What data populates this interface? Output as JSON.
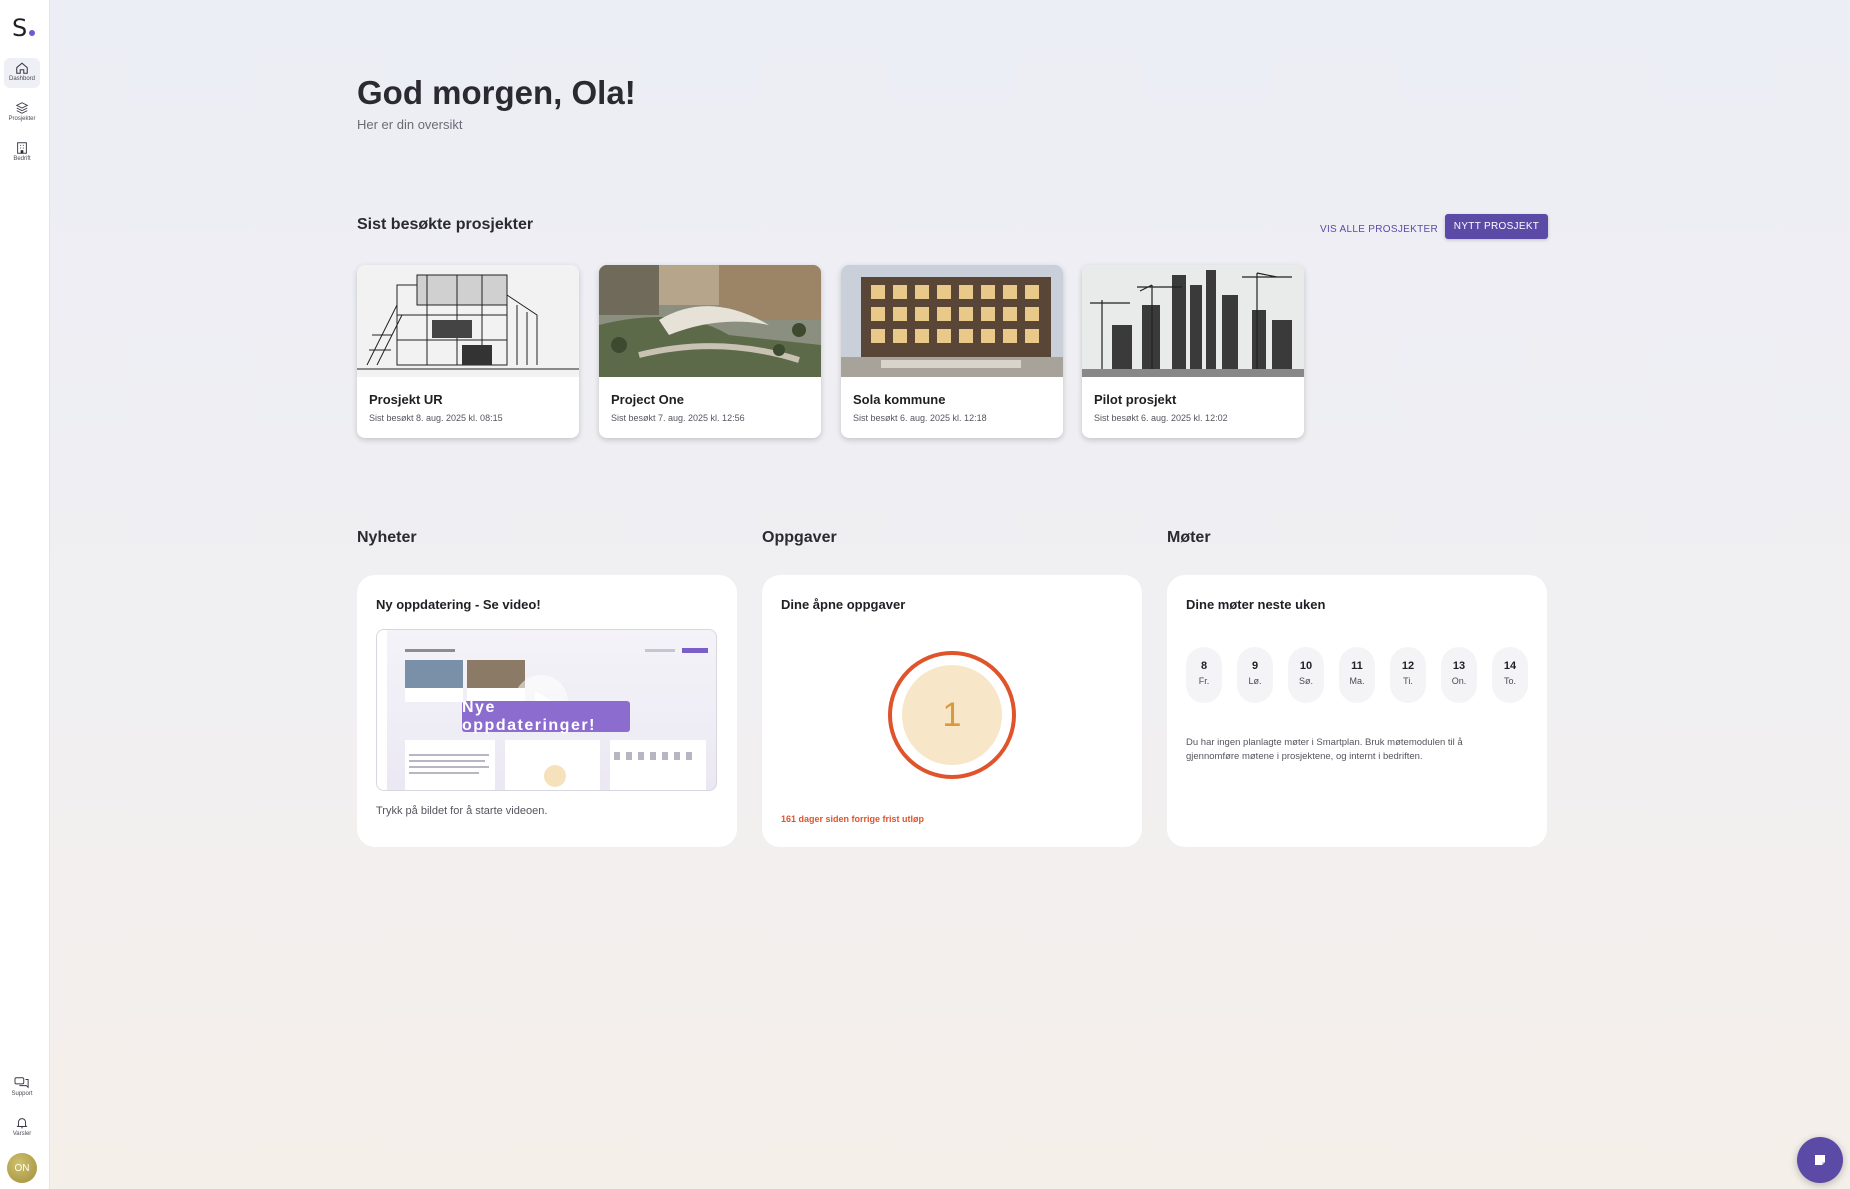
{
  "sidebar": {
    "logo": "S",
    "items": [
      {
        "label": "Dashbord",
        "icon": "home-icon"
      },
      {
        "label": "Prosjekter",
        "icon": "layers-icon"
      },
      {
        "label": "Bedrift",
        "icon": "building-icon"
      }
    ],
    "bottom": [
      {
        "label": "Support",
        "icon": "chat-bubbles-icon"
      },
      {
        "label": "Varsler",
        "icon": "bell-icon"
      }
    ],
    "avatar_initials": "ON"
  },
  "header": {
    "greeting": "God morgen, Ola!",
    "subtitle": "Her er din oversikt"
  },
  "recent": {
    "title": "Sist besøkte prosjekter",
    "view_all_label": "VIS ALLE PROSJEKTER",
    "new_project_label": "NYTT PROSJEKT",
    "projects": [
      {
        "name": "Prosjekt UR",
        "visited": "Sist besøkt 8. aug. 2025 kl. 08:15"
      },
      {
        "name": "Project One",
        "visited": "Sist besøkt 7. aug. 2025 kl. 12:56"
      },
      {
        "name": "Sola kommune",
        "visited": "Sist besøkt 6. aug. 2025 kl. 12:18"
      },
      {
        "name": "Pilot prosjekt",
        "visited": "Sist besøkt 6. aug. 2025 kl. 12:02"
      }
    ]
  },
  "news": {
    "section_title": "Nyheter",
    "card_title": "Ny oppdatering - Se video!",
    "video_banner": "Nye oppdateringer!",
    "caption": "Trykk på bildet for å starte videoen."
  },
  "tasks": {
    "section_title": "Oppgaver",
    "card_title": "Dine åpne oppgaver",
    "count": "1",
    "overdue_text": "161 dager siden forrige frist utløp"
  },
  "meetings": {
    "section_title": "Møter",
    "card_title": "Dine møter neste uken",
    "days": [
      {
        "num": "8",
        "wd": "Fr."
      },
      {
        "num": "9",
        "wd": "Lø."
      },
      {
        "num": "10",
        "wd": "Sø."
      },
      {
        "num": "11",
        "wd": "Ma."
      },
      {
        "num": "12",
        "wd": "Ti."
      },
      {
        "num": "13",
        "wd": "On."
      },
      {
        "num": "14",
        "wd": "To."
      }
    ],
    "info": "Du har ingen planlagte møter i Smartplan. Bruk møtemodulen til å gjennomføre møtene i prosjektene, og internt i bedriften."
  },
  "colors": {
    "accent": "#5b4aa6",
    "overdue": "#e0542c",
    "task_fill": "#f7e6c8"
  }
}
